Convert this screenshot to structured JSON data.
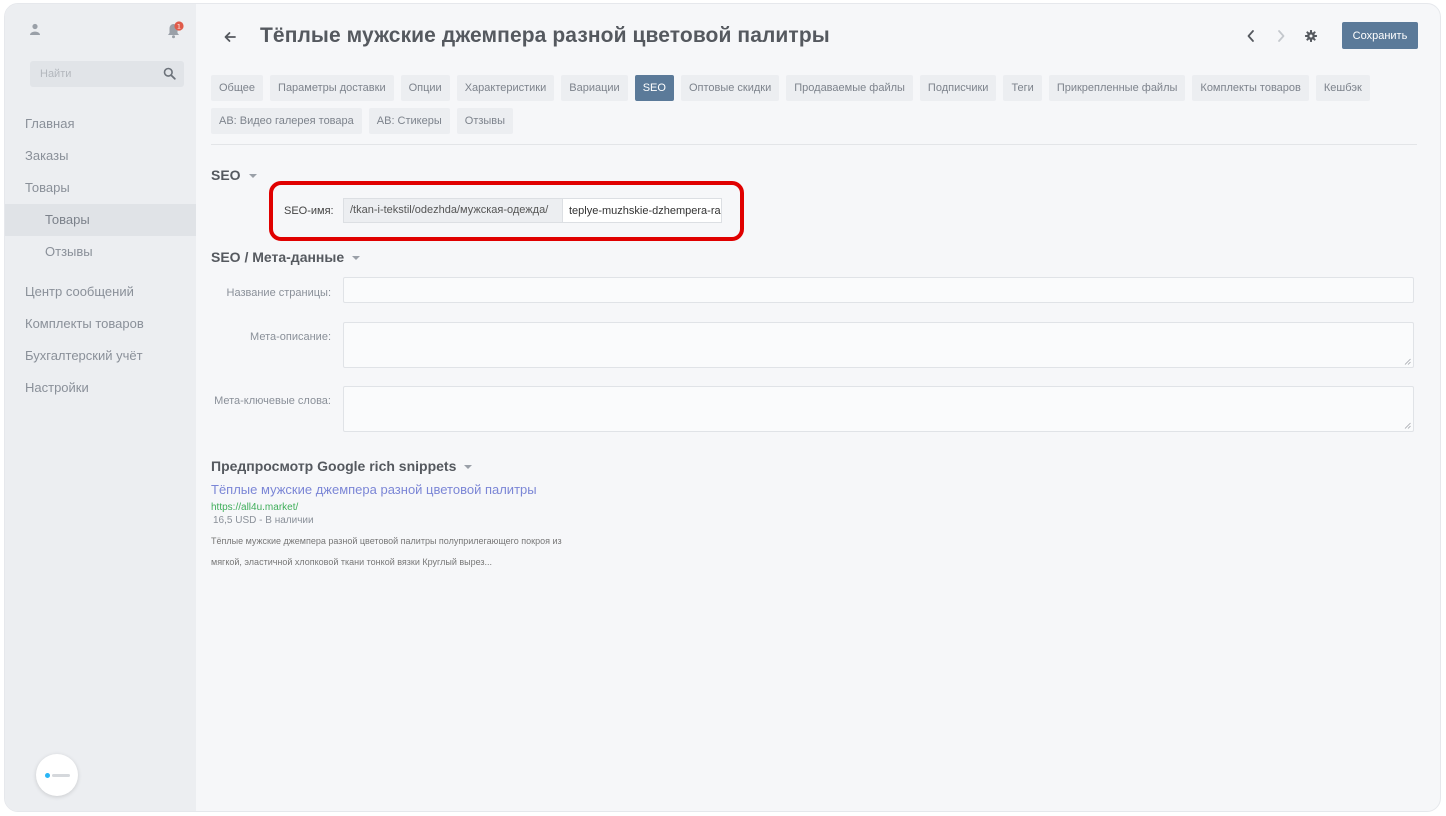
{
  "sidebar": {
    "notification_count": "1",
    "search_placeholder": "Найти",
    "items": [
      {
        "label": "Главная"
      },
      {
        "label": "Заказы"
      },
      {
        "label": "Товары"
      },
      {
        "label": "Товары"
      },
      {
        "label": "Отзывы"
      },
      {
        "label": "Центр сообщений"
      },
      {
        "label": "Комплекты товаров"
      },
      {
        "label": "Бухгалтерский учёт"
      },
      {
        "label": "Настройки"
      }
    ]
  },
  "header": {
    "title": "Тёплые мужские джемпера разной цветовой палитры",
    "save_label": "Сохранить"
  },
  "tabs": [
    "Общее",
    "Параметры доставки",
    "Опции",
    "Характеристики",
    "Вариации",
    "SEO",
    "Оптовые скидки",
    "Продаваемые файлы",
    "Подписчики",
    "Теги",
    "Прикрепленные файлы",
    "Комплекты товаров",
    "Кешбэк",
    "AB: Видео галерея товара",
    "AB: Стикеры",
    "Отзывы"
  ],
  "active_tab": "SEO",
  "seo": {
    "section_title": "SEO",
    "name_label": "SEO-имя:",
    "name_prefix": "/tkan-i-tekstil/odezhda/мужская-одежда/",
    "name_value": "teplye-muzhskie-dzhempera-ra"
  },
  "meta": {
    "section_title": "SEO / Мета-данные",
    "page_title_label": "Название страницы:",
    "page_title_value": "",
    "description_label": "Мета-описание:",
    "description_value": "",
    "keywords_label": "Мета-ключевые слова:",
    "keywords_value": ""
  },
  "preview": {
    "section_title": "Предпросмотр Google rich snippets",
    "title": "Тёплые мужские джемпера разной цветовой палитры",
    "url": "https://all4u.market/",
    "price": "16,5 USD - В наличии",
    "desc_line1": "Тёплые мужские джемпера разной цветовой палитры полуприлегающего покроя из",
    "desc_line2": "мягкой, эластичной хлопковой ткани тонкой вязки Круглый вырез..."
  },
  "colors": {
    "accent": "#5b7a99",
    "highlight": "#e00000",
    "snippet_title": "#7b86d6",
    "snippet_url": "#3fae5a"
  }
}
